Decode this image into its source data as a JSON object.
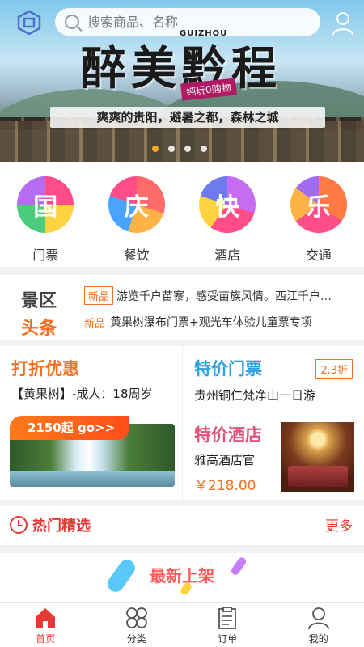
{
  "search": {
    "placeholder": "搜索商品、名称"
  },
  "banner": {
    "title": "醉美黔程",
    "subtitle_en": "GUIZHOU",
    "tag": "纯玩0购物",
    "slogan": "爽爽的贵阳，避暑之都，森林之城",
    "dots_total": 4,
    "active_dot": 1
  },
  "categories": [
    {
      "char": "国",
      "label": "门票"
    },
    {
      "char": "庆",
      "label": "餐饮"
    },
    {
      "char": "快",
      "label": "酒店"
    },
    {
      "char": "乐",
      "label": "交通"
    }
  ],
  "headlines": {
    "brand_top": "景区",
    "brand_bottom": "头条",
    "items": [
      {
        "tag": "新品",
        "text": "游览千户苗寨，感受苗族风情。西江千户…"
      },
      {
        "tag": "新品",
        "text": "黄果树瀑布门票+观光车体验儿童票专项"
      }
    ]
  },
  "promo": {
    "discount_title": "打折优惠",
    "discount_item": "【黄果树】-成人：18周岁",
    "discount_price": "2150起 go>>",
    "ticket_title": "特价门票",
    "ticket_badge": "2.3折",
    "ticket_item": "贵州铜仁梵净山一日游",
    "hotel_title": "特价酒店",
    "hotel_name": "雅高酒店官",
    "hotel_price": "￥218.00"
  },
  "hot": {
    "title": "热门精选",
    "more": "更多"
  },
  "new_arrivals": {
    "title": "最新上架"
  },
  "tabs": [
    {
      "label": "首页",
      "active": true
    },
    {
      "label": "分类",
      "active": false
    },
    {
      "label": "订单",
      "active": false
    },
    {
      "label": "我的",
      "active": false
    }
  ],
  "colors": {
    "accent": "#e53935",
    "orange": "#f36f21",
    "blue": "#2fa0e0",
    "pink": "#e0537a"
  }
}
